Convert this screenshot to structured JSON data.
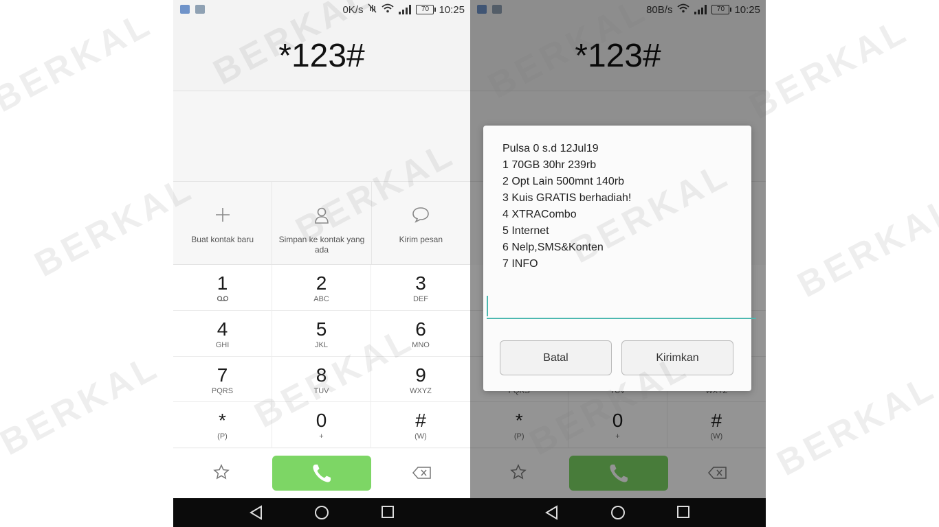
{
  "status_left": {
    "speed": "0K/s",
    "battery": "70",
    "time": "10:25"
  },
  "status_right": {
    "speed": "80B/s",
    "battery": "70",
    "time": "10:25"
  },
  "dialer": {
    "number": "*123#",
    "actions": [
      {
        "label": "Buat kontak baru",
        "icon": "add-icon"
      },
      {
        "label": "Simpan ke kontak yang ada",
        "icon": "person-icon"
      },
      {
        "label": "Kirim pesan",
        "icon": "message-icon"
      }
    ],
    "keys": [
      {
        "digit": "1",
        "letters": ""
      },
      {
        "digit": "2",
        "letters": "ABC"
      },
      {
        "digit": "3",
        "letters": "DEF"
      },
      {
        "digit": "4",
        "letters": "GHI"
      },
      {
        "digit": "5",
        "letters": "JKL"
      },
      {
        "digit": "6",
        "letters": "MNO"
      },
      {
        "digit": "7",
        "letters": "PQRS"
      },
      {
        "digit": "8",
        "letters": "TUV"
      },
      {
        "digit": "9",
        "letters": "WXYZ"
      },
      {
        "digit": "*",
        "letters": "(P)"
      },
      {
        "digit": "0",
        "letters": "+"
      },
      {
        "digit": "#",
        "letters": "(W)"
      }
    ],
    "call_color": "#7dd665"
  },
  "ussd_dialog": {
    "lines": [
      "Pulsa 0 s.d 12Jul19",
      "1 70GB 30hr 239rb",
      "2 Opt Lain 500mnt 140rb",
      "3 Kuis GRATIS berhadiah!",
      "4 XTRACombo",
      "5 Internet",
      "6 Nelp,SMS&Konten",
      "7 INFO"
    ],
    "input_value": "",
    "cancel_label": "Batal",
    "send_label": "Kirimkan",
    "accent": "#4cb8b0"
  },
  "watermark": "BERKAL"
}
